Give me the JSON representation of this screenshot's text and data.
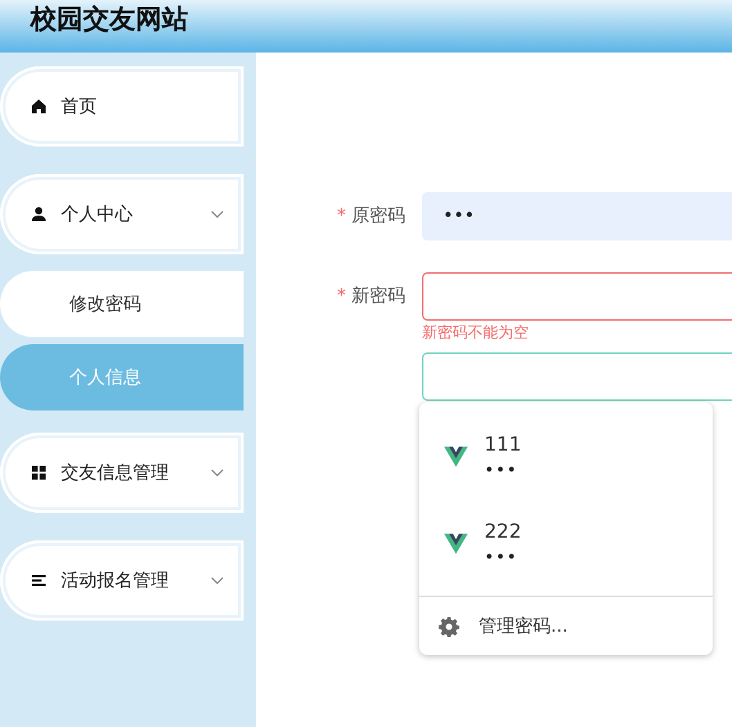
{
  "header": {
    "title": "校园交友网站"
  },
  "sidebar": {
    "items": [
      {
        "label": "首页",
        "kind": "home",
        "expandable": false
      },
      {
        "label": "个人中心",
        "kind": "user",
        "expandable": true,
        "children": [
          {
            "label": "修改密码",
            "selected": false
          },
          {
            "label": "个人信息",
            "selected": true
          }
        ]
      },
      {
        "label": "交友信息管理",
        "kind": "grid",
        "expandable": true
      },
      {
        "label": "活动报名管理",
        "kind": "list",
        "expandable": true
      }
    ]
  },
  "form": {
    "fields": [
      {
        "label": "原密码",
        "required_mark": "*",
        "value": "•••",
        "autofilled": true,
        "focused": false
      },
      {
        "label": "新密码",
        "required_mark": "*",
        "error": "新密码不能为空",
        "autofilled": false,
        "focused": false
      },
      {
        "autofilled": false,
        "focused": true
      }
    ]
  },
  "autocomplete": {
    "items": [
      {
        "name": "111",
        "password": "•••"
      },
      {
        "name": "222",
        "password": "•••"
      }
    ],
    "footer": "管理密码..."
  }
}
